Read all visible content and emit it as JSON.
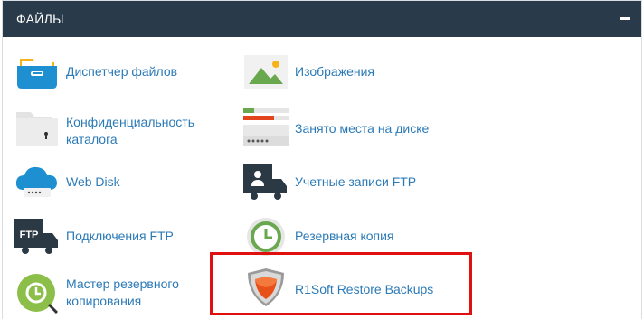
{
  "panel": {
    "title": "ФАЙЛЫ",
    "collapse_symbol": "−"
  },
  "items": [
    {
      "label": "Диспетчер файлов",
      "icon": "file-manager-icon"
    },
    {
      "label": "Изображения",
      "icon": "images-icon"
    },
    {
      "label": "Конфиденциальность каталога",
      "label_line1": "Конфиденциальность",
      "label_line2": "каталога",
      "icon": "directory-privacy-icon"
    },
    {
      "label": "Занято места на диске",
      "icon": "disk-usage-icon"
    },
    {
      "label": "Web Disk",
      "icon": "web-disk-icon"
    },
    {
      "label": "Учетные записи FTP",
      "icon": "ftp-accounts-icon"
    },
    {
      "label": "Подключения FTP",
      "icon": "ftp-connections-icon"
    },
    {
      "label": "Резервная копия",
      "icon": "backup-icon"
    },
    {
      "label": "Мастер резервного копирования",
      "label_line1": "Мастер резервного",
      "label_line2": "копирования",
      "icon": "backup-wizard-icon"
    },
    {
      "label": "R1Soft Restore Backups",
      "icon": "r1soft-shield-icon"
    }
  ],
  "colors": {
    "header_bg": "#293a4a",
    "link": "#2b7ab7",
    "highlight": "#e11010"
  }
}
